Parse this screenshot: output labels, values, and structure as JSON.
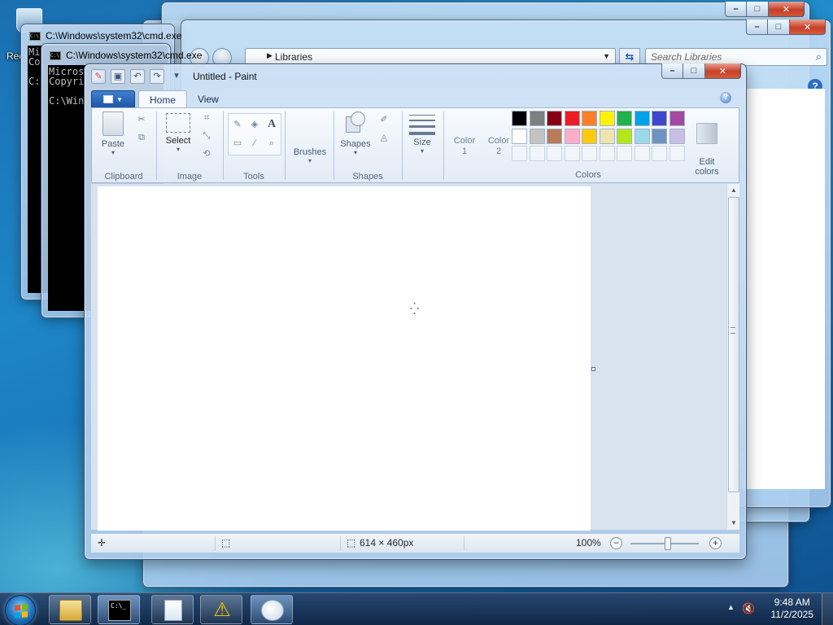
{
  "desktop": {
    "recycle_label": "Recy"
  },
  "cmd_back": {
    "title": "C:\\Windows\\system32\\cmd.exe",
    "lines": [
      "Mi",
      "Co",
      "",
      "C:"
    ]
  },
  "cmd_front": {
    "title": "C:\\Windows\\system32\\cmd.exe",
    "lines": [
      "Micros",
      "Copyri",
      "",
      "C:\\Win"
    ]
  },
  "explorer": {
    "address": "Libraries",
    "search_placeholder": "Search Libraries"
  },
  "paint": {
    "title": "Untitled - Paint",
    "tabs": [
      "Home",
      "View"
    ],
    "groups": {
      "clipboard": "Clipboard",
      "image": "Image",
      "tools": "Tools",
      "shapes": "Shapes",
      "colors": "Colors"
    },
    "buttons": {
      "paste": "Paste",
      "select": "Select",
      "brushes": "Brushes",
      "shapes": "Shapes",
      "size": "Size",
      "color1": "Color\n1",
      "color2": "Color\n2",
      "edit_colors": "Edit\ncolors"
    },
    "palette_row1": [
      "#000000",
      "#7f7f7f",
      "#880015",
      "#ed1c24",
      "#ff7f27",
      "#fff200",
      "#22b14c",
      "#00a2e8",
      "#3f48cc",
      "#a349a4"
    ],
    "palette_row2": [
      "#ffffff",
      "#c3c3c3",
      "#b97a57",
      "#ffaec9",
      "#ffc90e",
      "#efe4b0",
      "#b5e61d",
      "#99d9ea",
      "#7092be",
      "#c8bfe7"
    ],
    "status": {
      "image_size": "614 × 460px",
      "zoom": "100%"
    }
  },
  "taskbar": {
    "time": "9:48 AM",
    "date": "11/2/2025"
  }
}
